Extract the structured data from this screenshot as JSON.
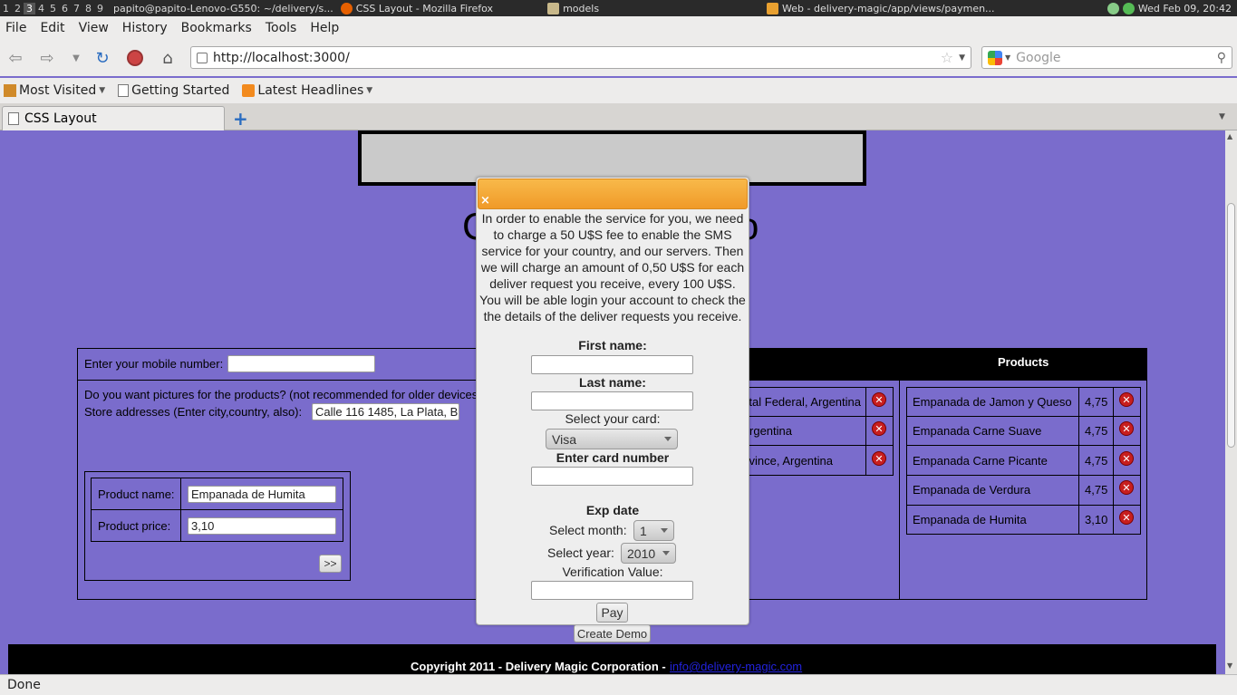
{
  "taskbar": {
    "workspaces": [
      "1",
      "2",
      "3",
      "4",
      "5",
      "6",
      "7",
      "8",
      "9"
    ],
    "tasks": [
      "papito@papito-Lenovo-G550: ~/delivery/s...",
      "CSS Layout - Mozilla Firefox",
      "models",
      "Web - delivery-magic/app/views/paymen..."
    ],
    "clock": "Wed Feb 09, 20:42"
  },
  "menu": [
    "File",
    "Edit",
    "View",
    "History",
    "Bookmarks",
    "Tools",
    "Help"
  ],
  "nav": {
    "url": "http://localhost:3000/",
    "search_placeholder": "Google"
  },
  "bookmarks": [
    "Most Visited",
    "Getting Started",
    "Latest Headlines"
  ],
  "tab": {
    "title": "CSS Layout"
  },
  "page": {
    "big_title_left": "C",
    "big_title_right": "o",
    "mobile_label": "Enter your mobile number:",
    "mobile_value": "",
    "pictures_label": "Do you want pictures for the products? (not recommended for older devices)",
    "store_label": "Store addresses (Enter city,country, also):",
    "store_value": "Calle 116 1485, La Plata, B",
    "product_name_label": "Product name:",
    "product_name_value": "Empanada de Humita",
    "product_price_label": "Product price:",
    "product_price_value": "3,10",
    "add_button": ">>",
    "addresses": [
      "...tal Federal, Argentina",
      "Argentina",
      "...vince, Argentina"
    ],
    "products_header": "Products",
    "products": [
      {
        "name": "Empanada de Jamon y Queso",
        "price": "4,75"
      },
      {
        "name": "Empanada Carne Suave",
        "price": "4,75"
      },
      {
        "name": "Empanada Carne Picante",
        "price": "4,75"
      },
      {
        "name": "Empanada de Verdura",
        "price": "4,75"
      },
      {
        "name": "Empanada de Humita",
        "price": "3,10"
      }
    ],
    "create_demo": "Create Demo",
    "footer_text": "Copyright 2011 - Delivery Magic Corporation - ",
    "footer_link": "info@delivery-magic.com"
  },
  "modal": {
    "close": "×",
    "intro": "In order to enable the service for you, we need to charge a 50 U$S fee to enable the SMS service for your country, and our servers. Then we will charge an amount of 0,50 U$S for each deliver request you receive, every 100 U$S. You will be able login your account to check the the details of the deliver requests you receive.",
    "first_name_label": "First name:",
    "last_name_label": "Last name:",
    "card_label": "Select your card:",
    "card_value": "Visa",
    "card_number_label": "Enter card number",
    "exp_label": "Exp date",
    "month_label": "Select month:",
    "month_value": "1",
    "year_label": "Select year:",
    "year_value": "2010",
    "verif_label": "Verification Value:",
    "pay": "Pay"
  },
  "status": "Done",
  "colors": {
    "page_bg": "#7a6ccc",
    "modal_header": "#f4a93a",
    "footer_bg": "#000000"
  }
}
